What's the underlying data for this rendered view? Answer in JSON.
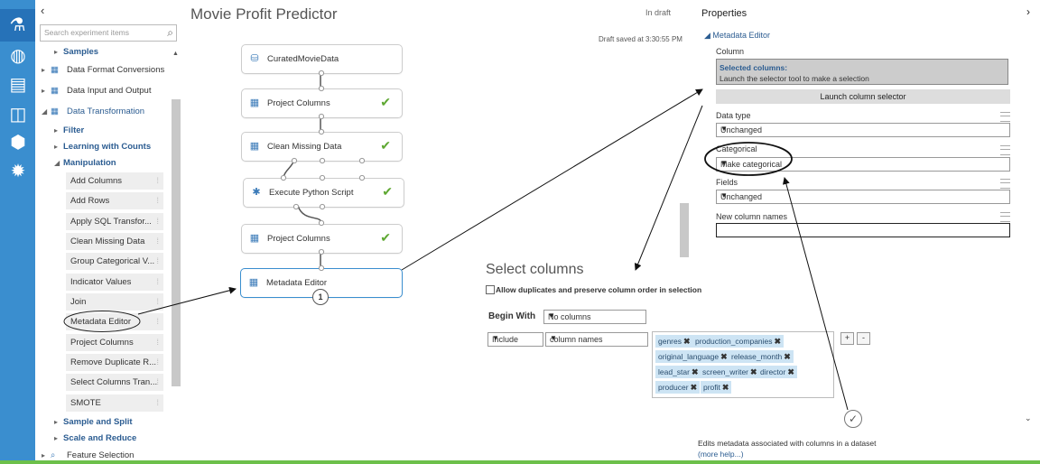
{
  "palette": {
    "search_placeholder": "Search experiment items",
    "tree": [
      {
        "label": "Samples",
        "arrow": "▸"
      },
      {
        "label": "Data Format Conversions",
        "arrow": "▸"
      },
      {
        "label": "Data Input and Output",
        "arrow": "▸"
      },
      {
        "label": "Data Transformation",
        "arrow": "◢"
      },
      {
        "label": "Filter",
        "arrow": "▸"
      },
      {
        "label": "Learning with Counts",
        "arrow": "▸"
      },
      {
        "label": "Manipulation",
        "arrow": "◢"
      },
      {
        "label": "Sample and Split",
        "arrow": "▸"
      },
      {
        "label": "Scale and Reduce",
        "arrow": "▸"
      },
      {
        "label": "Feature Selection",
        "arrow": "▸"
      }
    ],
    "modules": [
      "Add Columns",
      "Add Rows",
      "Apply SQL Transfor...",
      "Clean Missing Data",
      "Group Categorical V...",
      "Indicator Values",
      "Join",
      "Metadata Editor",
      "Project Columns",
      "Remove Duplicate R...",
      "Select Columns Tran...",
      "SMOTE"
    ]
  },
  "canvas": {
    "title": "Movie Profit Predictor",
    "status": "In draft",
    "saved": "Draft saved at 3:30:55 PM",
    "nodes": [
      "CuratedMovieData",
      "Project Columns",
      "Clean Missing Data",
      "Execute Python Script",
      "Project Columns",
      "Metadata Editor"
    ],
    "badge": "1"
  },
  "properties": {
    "title": "Properties",
    "section": "Metadata Editor",
    "column_label": "Column",
    "selected_title": "Selected columns:",
    "selected_hint": "Launch the selector tool to make a selection",
    "launch_button": "Launch column selector",
    "data_type_label": "Data type",
    "data_type_value": "Unchanged",
    "categorical_label": "Categorical",
    "categorical_value": "Make categorical",
    "fields_label": "Fields",
    "fields_value": "Unchanged",
    "new_names_label": "New column names",
    "help_text": "Edits metadata associated with columns in a dataset",
    "help_link": "(more help...)"
  },
  "dialog": {
    "title": "Select columns",
    "allow_label": "Allow duplicates and preserve column order in selection",
    "begin_with_label": "Begin With",
    "begin_with_value": "No columns",
    "include_value": "Include",
    "column_names_value": "column names",
    "columns": [
      "genres",
      "production_companies",
      "original_language",
      "release_month",
      "lead_star",
      "screen_writer",
      "director",
      "producer",
      "profit"
    ],
    "plus": "+",
    "minus": "-"
  },
  "colors": {
    "rail": "#3a8ecf",
    "accent": "#2b5c91",
    "check": "#5ea832"
  }
}
